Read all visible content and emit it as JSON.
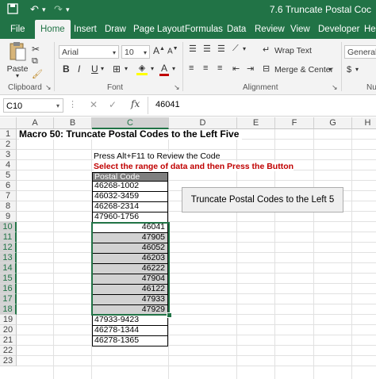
{
  "window": {
    "title": "7.6 Truncate Postal Coc"
  },
  "ribbon_tabs": [
    "File",
    "Home",
    "Insert",
    "Draw",
    "Page Layout",
    "Formulas",
    "Data",
    "Review",
    "View",
    "Developer",
    "Hel"
  ],
  "ribbon": {
    "clipboard": {
      "paste": "Paste",
      "label": "Clipboard"
    },
    "font": {
      "name": "Arial",
      "size": "10",
      "bold": "B",
      "italic": "I",
      "underline": "U",
      "label": "Font"
    },
    "alignment": {
      "wrap": "Wrap Text",
      "merge": "Merge & Center",
      "label": "Alignment"
    },
    "number": {
      "format": "General",
      "label": "Nu"
    }
  },
  "formula_bar": {
    "name_box": "C10",
    "fx": "fx",
    "value": "46041"
  },
  "columns": [
    "A",
    "B",
    "C",
    "D",
    "E",
    "F",
    "G",
    "H"
  ],
  "rows": [
    "1",
    "2",
    "3",
    "4",
    "5",
    "6",
    "7",
    "8",
    "9",
    "10",
    "11",
    "12",
    "13",
    "14",
    "15",
    "16",
    "17",
    "18",
    "19",
    "20",
    "21",
    "22",
    "23"
  ],
  "sheet": {
    "title": "Macro 50: Truncate Postal Codes to the Left Five",
    "instruction1": "Press Alt+F11 to Review the Code",
    "instruction2": "Select the range of data and then Press the Button",
    "table_header": "Postal Code",
    "postal_codes": [
      "46268-1002",
      "46032-3459",
      "46268-2314",
      "47960-1756",
      "46041",
      "47905",
      "46052",
      "46203",
      "46222",
      "47904",
      "46122",
      "47933",
      "47929",
      "47933-9423",
      "46278-1344",
      "46278-1365"
    ],
    "button_label": "Truncate Postal Codes to the Left 5"
  },
  "colors": {
    "accent": "#217346",
    "error_text": "#c00000",
    "selection": "#d2d2d2"
  }
}
